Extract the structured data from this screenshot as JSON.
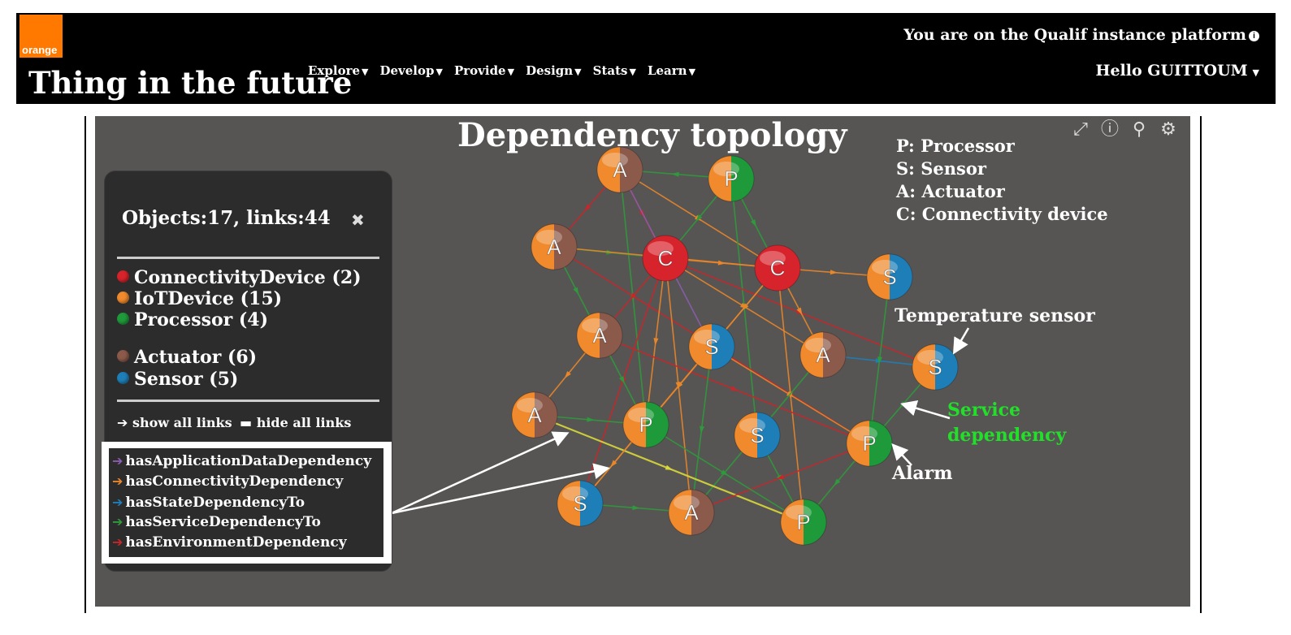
{
  "header": {
    "logo_text": "orange",
    "title": "Thing in the future",
    "nav": [
      {
        "label": "Explore"
      },
      {
        "label": "Develop"
      },
      {
        "label": "Provide"
      },
      {
        "label": "Design"
      },
      {
        "label": "Stats"
      },
      {
        "label": "Learn"
      }
    ],
    "platform_notice": "You are on the Qualif instance platform",
    "greeting": "Hello GUITTOUM"
  },
  "graph": {
    "title": "Dependency topology",
    "abbreviations": [
      "P: Processor",
      "S: Sensor",
      "A: Actuator",
      "C: Connectivity device"
    ],
    "annotations": {
      "temperature_sensor": "Temperature sensor",
      "service_dependency": "Service dependency",
      "alarm": "Alarm"
    },
    "colors": {
      "connectivity": "#d7232b",
      "iot": "#f08a2d",
      "processor": "#1f9a3a",
      "actuator": "#8c5a4a",
      "sensor": "#1e7fb8",
      "link_application": "#8a5db0",
      "link_connectivity": "#e8862a",
      "link_state": "#1e7fb8",
      "link_service": "#2f9a3c",
      "link_environment": "#c8262a",
      "highlight": "#d8d83a"
    },
    "nodes": [
      {
        "label": "A",
        "type": "actuator"
      },
      {
        "label": "P",
        "type": "processor"
      },
      {
        "label": "A",
        "type": "actuator"
      },
      {
        "label": "C",
        "type": "connectivity"
      },
      {
        "label": "C",
        "type": "connectivity"
      },
      {
        "label": "S",
        "type": "sensor"
      },
      {
        "label": "A",
        "type": "actuator"
      },
      {
        "label": "S",
        "type": "sensor"
      },
      {
        "label": "A",
        "type": "actuator"
      },
      {
        "label": "S",
        "type": "sensor"
      },
      {
        "label": "A",
        "type": "actuator"
      },
      {
        "label": "P",
        "type": "processor"
      },
      {
        "label": "S",
        "type": "sensor"
      },
      {
        "label": "P",
        "type": "processor"
      },
      {
        "label": "S",
        "type": "sensor"
      },
      {
        "label": "A",
        "type": "actuator"
      },
      {
        "label": "P",
        "type": "processor"
      }
    ]
  },
  "legend": {
    "counts": "Objects:17, links:44",
    "items": [
      {
        "label": "ConnectivityDevice (2)",
        "color": "#d7232b"
      },
      {
        "label": "IoTDevice (15)",
        "color": "#f08a2d"
      },
      {
        "label": "Processor (4)",
        "color": "#1f9a3a"
      },
      {
        "label": "Actuator (6)",
        "color": "#8c5a4a"
      },
      {
        "label": "Sensor (5)",
        "color": "#1e7fb8"
      }
    ],
    "show_all": "show all links",
    "hide_all": "hide all links",
    "link_types": [
      {
        "label": "hasApplicationDataDependency",
        "color": "#8a5db0"
      },
      {
        "label": "hasConnectivityDependency",
        "color": "#e8862a"
      },
      {
        "label": "hasStateDependencyTo",
        "color": "#1e7fb8"
      },
      {
        "label": "hasServiceDependencyTo",
        "color": "#2f9a3c"
      },
      {
        "label": "hasEnvironmentDependency",
        "color": "#c8262a"
      }
    ]
  }
}
